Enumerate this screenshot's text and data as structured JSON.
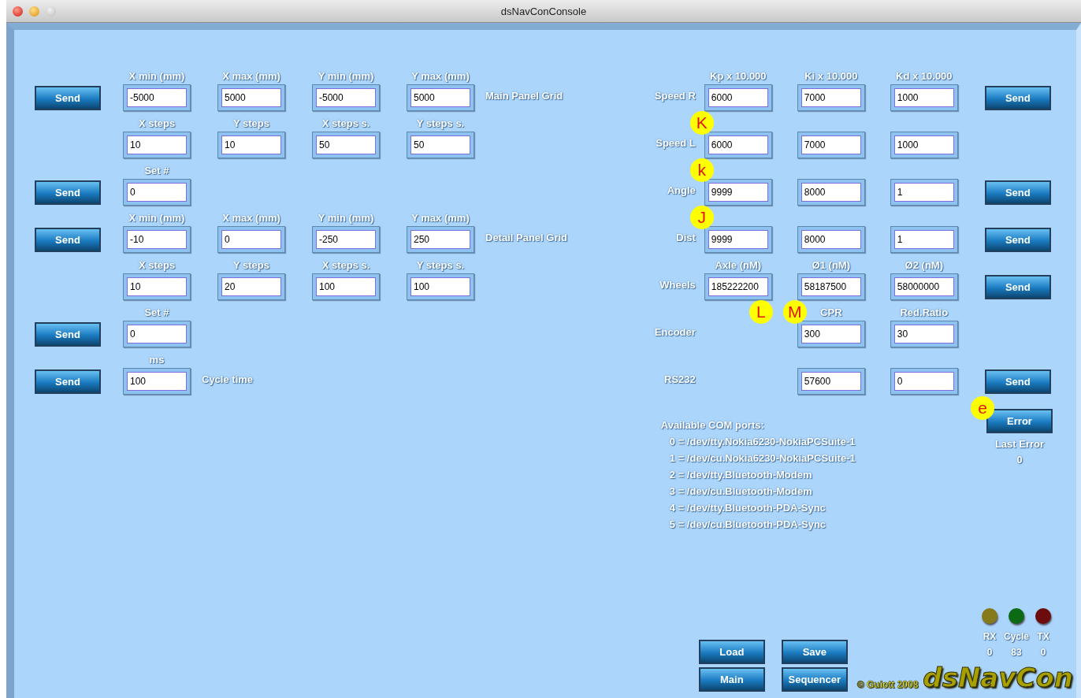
{
  "window": {
    "title": "dsNavConConsole"
  },
  "grid_panel": {
    "rows": [
      {
        "button": "Send",
        "cells": [
          {
            "header": "X min (mm)",
            "value": "-5000"
          },
          {
            "header": "X max (mm)",
            "value": "5000"
          },
          {
            "header": "Y min (mm)",
            "value": "-5000"
          },
          {
            "header": "Y max (mm)",
            "value": "5000"
          }
        ],
        "caption": "Main Panel Grid"
      },
      {
        "cells": [
          {
            "header": "X steps",
            "value": "10"
          },
          {
            "header": "Y steps",
            "value": "10"
          },
          {
            "header": "X steps s.",
            "value": "50"
          },
          {
            "header": "Y steps s.",
            "value": "50"
          }
        ]
      },
      {
        "button": "Send",
        "cells": [
          {
            "header": "Set #",
            "value": "0"
          }
        ]
      },
      {
        "button": "Send",
        "cells": [
          {
            "header": "X min (mm)",
            "value": "-10"
          },
          {
            "header": "X max (mm)",
            "value": "0"
          },
          {
            "header": "Y min (mm)",
            "value": "-250"
          },
          {
            "header": "Y max (mm)",
            "value": "250"
          }
        ],
        "caption": "Detail Panel Grid"
      },
      {
        "cells": [
          {
            "header": "X steps",
            "value": "10"
          },
          {
            "header": "Y steps",
            "value": "20"
          },
          {
            "header": "X steps s.",
            "value": "100"
          },
          {
            "header": "Y steps s.",
            "value": "100"
          }
        ]
      },
      {
        "button": "Send",
        "cells": [
          {
            "header": "Set #",
            "value": "0"
          }
        ]
      },
      {
        "button": "Send",
        "cells": [
          {
            "header": "ms",
            "value": "100"
          }
        ],
        "caption": "Cycle time"
      }
    ]
  },
  "pid_panel": {
    "rows": [
      {
        "label": "Speed R",
        "cells": [
          {
            "kind": "field",
            "header": "Kp x 10.000",
            "value": "6000"
          },
          {
            "kind": "field",
            "header": "Ki x 10.000",
            "value": "7000"
          },
          {
            "kind": "field",
            "header": "Kd x 10.000",
            "value": "1000"
          }
        ],
        "button": "Send"
      },
      {
        "label": "Speed L",
        "cells": [
          {
            "kind": "field",
            "value": "6000",
            "marker": "K"
          },
          {
            "kind": "field",
            "value": "7000"
          },
          {
            "kind": "field",
            "value": "1000"
          }
        ]
      },
      {
        "label": "Angle",
        "cells": [
          {
            "kind": "field",
            "value": "9999",
            "marker": "k"
          },
          {
            "kind": "field",
            "value": "8000"
          },
          {
            "kind": "field",
            "value": "1"
          }
        ],
        "button": "Send"
      },
      {
        "label": "Dist",
        "cells": [
          {
            "kind": "field",
            "value": "9999",
            "marker": "J"
          },
          {
            "kind": "field",
            "value": "8000"
          },
          {
            "kind": "field",
            "value": "1"
          }
        ],
        "button": "Send"
      },
      {
        "label": "Wheels",
        "cells": [
          {
            "kind": "field",
            "header": "Axle (nM)",
            "value": "185222200"
          },
          {
            "kind": "field",
            "header": "Ø1 (nM)",
            "value": "58187500"
          },
          {
            "kind": "field",
            "header": "Ø2 (nM)",
            "value": "58000000"
          }
        ],
        "button": "Send"
      },
      {
        "label": "Encoder",
        "cells": [
          {
            "kind": "blank",
            "marker": "L"
          },
          {
            "kind": "field",
            "header": "CPR",
            "value": "300",
            "marker": "M"
          },
          {
            "kind": "field",
            "header": "Red.Ratio",
            "value": "30"
          }
        ]
      },
      {
        "label": "RS232",
        "cells": [
          {
            "kind": "blank"
          },
          {
            "kind": "field",
            "value": "57600"
          },
          {
            "kind": "field",
            "value": "0"
          }
        ],
        "button": "Send"
      }
    ]
  },
  "com_ports": {
    "title": "Available COM ports:",
    "ports": [
      "0 = /dev/tty.Nokia6230-NokiaPCSuite-1",
      "1 = /dev/cu.Nokia6230-NokiaPCSuite-1",
      "2 = /dev/tty.Bluetooth-Modem",
      "3 = /dev/cu.Bluetooth-Modem",
      "4 = /dev/tty.Bluetooth-PDA-Sync",
      "5 = /dev/cu.Bluetooth-PDA-Sync"
    ]
  },
  "error": {
    "button": "Error",
    "marker": "e",
    "label": "Last Error",
    "value": "0"
  },
  "indicators": [
    {
      "label": "RX",
      "value": "0",
      "color": "#857a1c"
    },
    {
      "label": "Cycle",
      "value": "83",
      "color": "#0c6a14"
    },
    {
      "label": "TX",
      "value": "0",
      "color": "#6c0c0c"
    }
  ],
  "footer_buttons": [
    "Load",
    "Save",
    "Main",
    "Sequencer"
  ],
  "copyright": "© Guiott 2008",
  "logo": "dsNavCon"
}
